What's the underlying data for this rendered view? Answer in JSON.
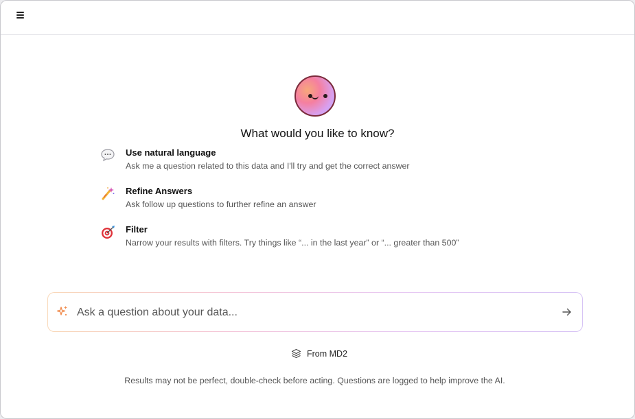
{
  "header": {
    "menu_icon": "hamburger-menu-icon"
  },
  "assistant": {
    "avatar_icon": "smiley-face-avatar",
    "headline": "What would you like to know?"
  },
  "features": [
    {
      "icon": "speech-bubble-icon",
      "title": "Use natural language",
      "description": "Ask me a question related to this data and I'll try and get the correct answer"
    },
    {
      "icon": "magic-wand-icon",
      "title": "Refine Answers",
      "description": "Ask follow up questions to further refine an answer"
    },
    {
      "icon": "target-icon",
      "title": "Filter",
      "description": "Narrow your results with filters. Try things like “... in the last year” or “... greater than 500”"
    }
  ],
  "search": {
    "placeholder": "Ask a question about your data...",
    "value": "",
    "sparkle_icon": "sparkle-icon",
    "submit_icon": "arrow-right-icon"
  },
  "source": {
    "icon": "layers-icon",
    "label": "From MD2"
  },
  "footer": {
    "disclaimer": "Results may not be perfect, double-check before acting. Questions are logged to help improve the AI."
  },
  "colors": {
    "accent": "#f08a4b",
    "text_primary": "#111111",
    "text_secondary": "#555555",
    "border": "#e6e6ea"
  }
}
